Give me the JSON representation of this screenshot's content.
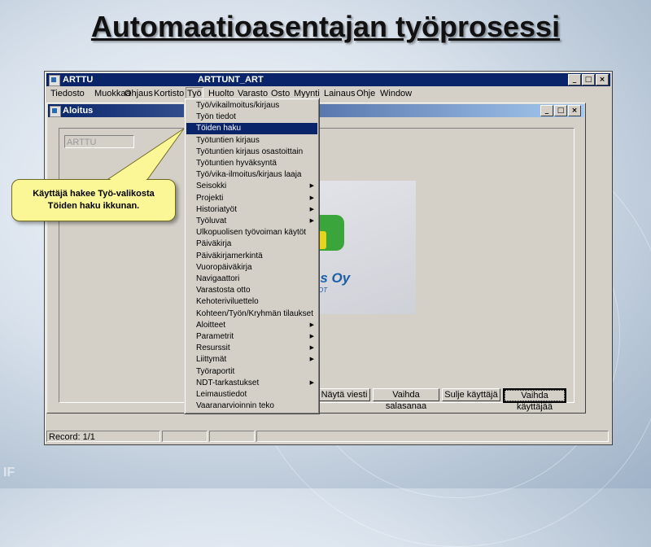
{
  "slide": {
    "title": "Automaatioasentajan työprosessi"
  },
  "app": {
    "title_left": "ARTTU",
    "title_center": "ARTTUNT_ART",
    "window_buttons": [
      "_",
      "□",
      "×"
    ],
    "menu": [
      "Tiedosto",
      "Muokkaa",
      "Ohjaus",
      "Kortisto",
      "Työ",
      "Huolto",
      "Varasto",
      "Osto",
      "Myynti",
      "Lainaus",
      "Ohje",
      "Window"
    ],
    "active_menu": "Työ"
  },
  "inner": {
    "title": "Aloitus",
    "field_value": "ARTTU",
    "logo_text": "us Oy",
    "logo_sub": "OT"
  },
  "dropdown_items": [
    {
      "label": "Työ/vikailmoitus/kirjaus",
      "submenu": false,
      "highlighted": false
    },
    {
      "label": "Työn tiedot",
      "submenu": false,
      "highlighted": false
    },
    {
      "label": "Töiden haku",
      "submenu": false,
      "highlighted": true
    },
    {
      "label": "Työtuntien kirjaus",
      "submenu": false,
      "highlighted": false
    },
    {
      "label": "Työtuntien kirjaus osastoittain",
      "submenu": false,
      "highlighted": false
    },
    {
      "label": "Työtuntien hyväksyntä",
      "submenu": false,
      "highlighted": false
    },
    {
      "label": "Työ/vika-ilmoitus/kirjaus laaja",
      "submenu": false,
      "highlighted": false
    },
    {
      "label": "Seisokki",
      "submenu": true,
      "highlighted": false
    },
    {
      "label": "Projekti",
      "submenu": true,
      "highlighted": false
    },
    {
      "label": "Historiatyöt",
      "submenu": true,
      "highlighted": false
    },
    {
      "label": "Työluvat",
      "submenu": true,
      "highlighted": false
    },
    {
      "label": "Ulkopuolisen työvoiman käytöt",
      "submenu": false,
      "highlighted": false
    },
    {
      "label": "Päiväkirja",
      "submenu": false,
      "highlighted": false
    },
    {
      "label": "Päiväkirjamerkintä",
      "submenu": false,
      "highlighted": false
    },
    {
      "label": "Vuoropäiväkirja",
      "submenu": false,
      "highlighted": false
    },
    {
      "label": "Navigaattori",
      "submenu": false,
      "highlighted": false
    },
    {
      "label": "Varastosta otto",
      "submenu": false,
      "highlighted": false
    },
    {
      "label": "Kehoteriviluettelo",
      "submenu": false,
      "highlighted": false
    },
    {
      "label": "Kohteen/Työn/Kryhmän tilaukset",
      "submenu": false,
      "highlighted": false
    },
    {
      "label": "Aloitteet",
      "submenu": true,
      "highlighted": false
    },
    {
      "label": "Parametrit",
      "submenu": true,
      "highlighted": false
    },
    {
      "label": "Resurssit",
      "submenu": true,
      "highlighted": false
    },
    {
      "label": "Liittymät",
      "submenu": true,
      "highlighted": false
    },
    {
      "label": "Työraportit",
      "submenu": false,
      "highlighted": false
    },
    {
      "label": "NDT-tarkastukset",
      "submenu": true,
      "highlighted": false
    },
    {
      "label": "Leimaustiedot",
      "submenu": false,
      "highlighted": false
    },
    {
      "label": "Vaaranarvioinnin teko",
      "submenu": false,
      "highlighted": false
    }
  ],
  "buttons": [
    "Näytä viesti",
    "Vaihda salasanaa",
    "Sulje käyttäjä",
    "Vaihda käyttäjää"
  ],
  "focused_button": "Vaihda käyttäjää",
  "status": {
    "record": "Record: 1/1"
  },
  "callout": {
    "line1": "Käyttäjä hakee Työ-valikosta",
    "line2": "Töiden haku ikkunan."
  },
  "colors": {
    "titlebar": "#0a246a",
    "highlight": "#0a246a",
    "callout_bg": "#fbf796",
    "window_bg": "#d4d0c8"
  },
  "icons": {
    "app_icon": "app-icon",
    "submenu_arrow": "triangle-right-icon"
  }
}
